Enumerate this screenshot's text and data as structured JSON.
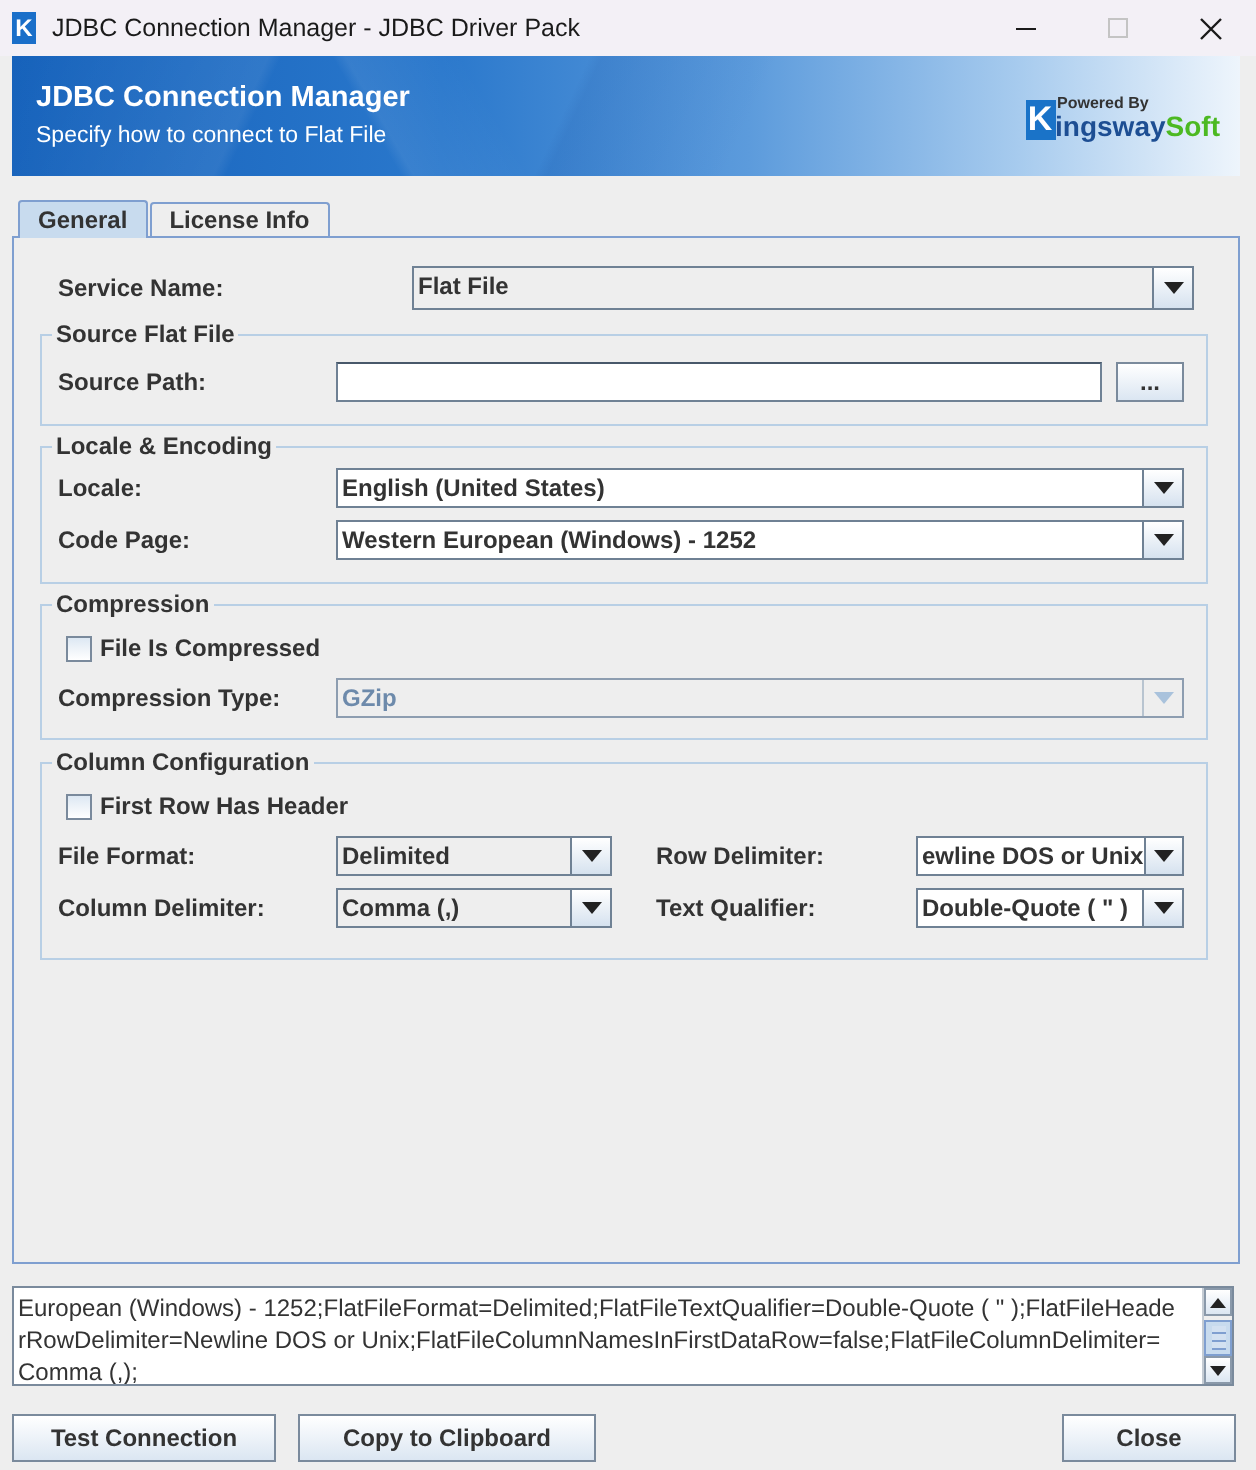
{
  "window": {
    "icon_letter": "K",
    "title": "JDBC Connection Manager - JDBC Driver Pack",
    "buttons": [
      {
        "kind": "minimize",
        "disabled": false
      },
      {
        "kind": "maximize",
        "disabled": true
      },
      {
        "kind": "close",
        "disabled": false
      }
    ]
  },
  "header": {
    "title": "JDBC Connection Manager",
    "subtitle": "Specify how to connect to Flat File",
    "logo": {
      "caption": "Powered By",
      "letter": "K",
      "word": "ingsway",
      "suffix": "Soft"
    }
  },
  "tabs": [
    {
      "label": "General",
      "selected": true
    },
    {
      "label": "License Info",
      "selected": false
    }
  ],
  "service": {
    "label": "Service Name:",
    "value": "Flat File",
    "editable": false,
    "disabled": false
  },
  "groups": [
    {
      "title": "Source Flat File",
      "rows": [
        {
          "kind": "file",
          "label": "Source Path:",
          "button": "..."
        }
      ]
    },
    {
      "title": "Locale & Encoding",
      "rows": [
        {
          "kind": "combo",
          "label": "Locale:",
          "value": "English (United States)",
          "editable": true,
          "disabled": false
        },
        {
          "kind": "combo",
          "label": "Code Page:",
          "value": "Western European (Windows) - 1252",
          "editable": true,
          "disabled": false
        }
      ]
    },
    {
      "title": "Compression",
      "rows": [
        {
          "kind": "checkbox",
          "label": "File Is Compressed",
          "checked": false
        },
        {
          "kind": "combo",
          "label": "Compression Type:",
          "value": "GZip",
          "editable": false,
          "disabled": true
        }
      ]
    },
    {
      "title": "Column Configuration",
      "rows": [
        {
          "kind": "checkbox",
          "label": "First Row Has Header",
          "checked": false
        },
        {
          "kind": "combo_pair",
          "fields": [
            {
              "label": "File Format:",
              "value": "Delimited",
              "editable": false,
              "disabled": false
            },
            {
              "label": "Row Delimiter:",
              "value": "ewline DOS or Unix",
              "editable": true,
              "disabled": false
            }
          ]
        },
        {
          "kind": "combo_pair",
          "fields": [
            {
              "label": "Column Delimiter:",
              "value": "Comma (,)",
              "editable": false,
              "disabled": false
            },
            {
              "label": "Text Qualifier:",
              "value": "Double-Quote ( \" )",
              "editable": true,
              "disabled": false
            }
          ]
        }
      ]
    }
  ],
  "connection_string": {
    "lines": [
      "European (Windows) - 1252;FlatFileFormat=Delimited;FlatFileTextQualifier=Double-Quote ( \" );FlatFileHeade",
      "rRowDelimiter=Newline DOS or Unix;FlatFileColumnNamesInFirstDataRow=false;FlatFileColumnDelimiter=",
      "Comma (,);"
    ]
  },
  "buttons": [
    "Test Connection",
    "Copy to Clipboard",
    "Close"
  ]
}
